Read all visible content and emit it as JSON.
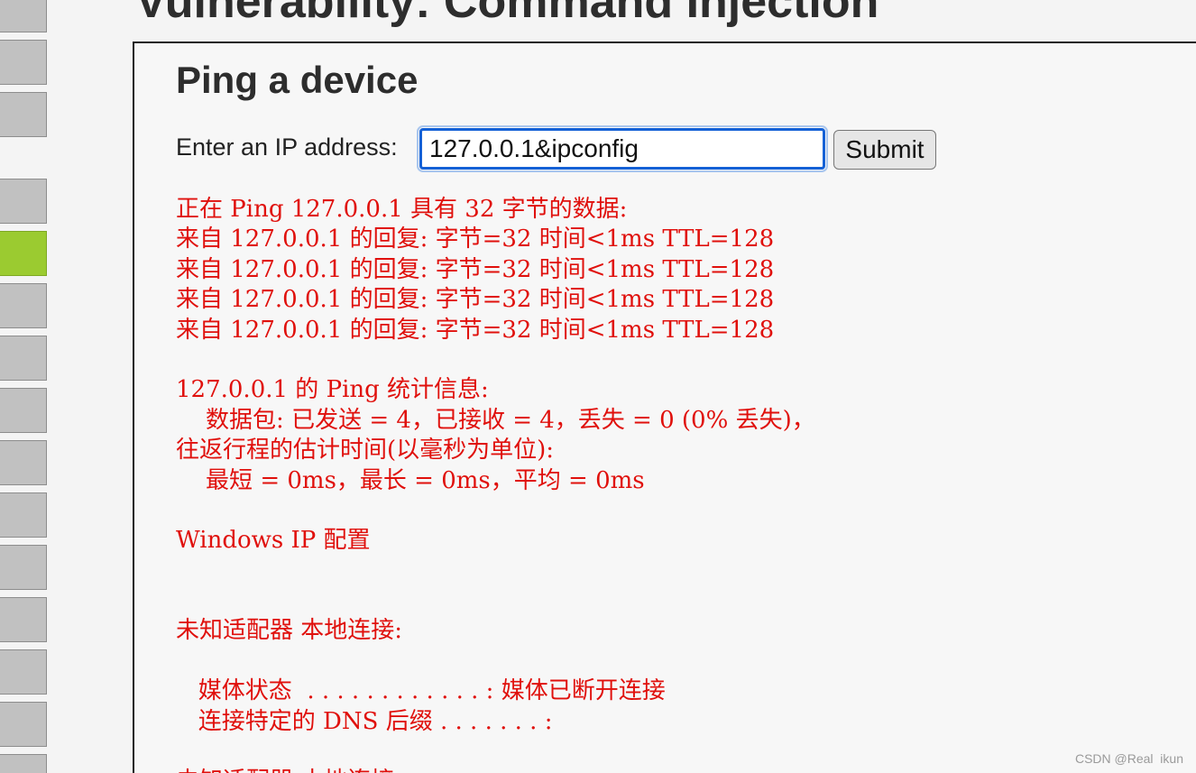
{
  "header": {
    "title": "Vulnerability: Command Injection"
  },
  "sidebar": {
    "active_index": 4
  },
  "form": {
    "heading": "Ping a device",
    "ip_label": "Enter an IP address:",
    "ip_value": "127.0.0.1&ipconfig",
    "submit_label": "Submit"
  },
  "output": {
    "lines": [
      "正在 Ping 127.0.0.1 具有 32 字节的数据:",
      "来自 127.0.0.1 的回复: 字节=32 时间<1ms TTL=128",
      "来自 127.0.0.1 的回复: 字节=32 时间<1ms TTL=128",
      "来自 127.0.0.1 的回复: 字节=32 时间<1ms TTL=128",
      "来自 127.0.0.1 的回复: 字节=32 时间<1ms TTL=128",
      "",
      "127.0.0.1 的 Ping 统计信息:",
      "    数据包: 已发送 = 4，已接收 = 4，丢失 = 0 (0% 丢失)，",
      "往返行程的估计时间(以毫秒为单位):",
      "    最短 = 0ms，最长 = 0ms，平均 = 0ms",
      "",
      "Windows IP 配置",
      "",
      "",
      "未知适配器 本地连接:",
      "",
      "   媒体状态  . . . . . . . . . . . . : 媒体已断开连接",
      "   连接特定的 DNS 后缀 . . . . . . . :",
      "",
      "未知适配器 本地连接:"
    ]
  },
  "watermark": {
    "text": "CSDN @Real  ikun"
  },
  "colors": {
    "output_text": "#e0100c",
    "menu_active": "#9bcb30",
    "menu_default": "#c1c1c1",
    "input_focus": "#1561d6"
  }
}
